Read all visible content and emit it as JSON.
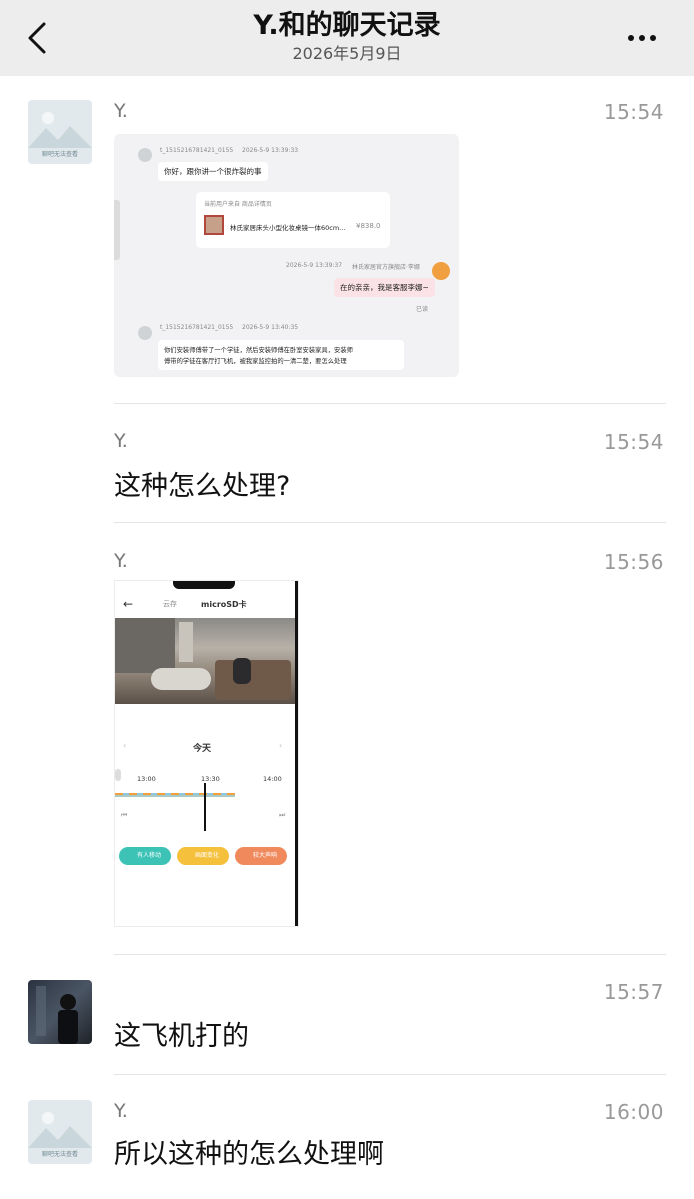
{
  "header": {
    "title": "Y.和的聊天记录",
    "date": "2026年5月9日",
    "back_icon": "chevron-left-icon",
    "more_icon": "more-dots-icon"
  },
  "messages": [
    {
      "name": "Y.",
      "time": "15:54",
      "avatar_text": "聊吧无法查看",
      "type": "image",
      "screenshot": {
        "user_id_1": "t_1515216781421_0155",
        "ts_1": "2026-5-9 13:39:33",
        "msg_1": "你好，跟你讲一个很炸裂的事",
        "product_src": "当前用户来自 商品详情页",
        "product_name": "林氏家居床头小型化妆桌镜一体60cm...",
        "product_price": "¥838.0",
        "ts_2": "2026-5-9 13:39:37",
        "shop_name": "林氏家居官方旗舰店·李娜",
        "msg_2": "在的亲亲，我是客服李娜~",
        "read_status": "已读",
        "user_id_2": "t_1515216781421_0155",
        "ts_3": "2026-5-9 13:40:35",
        "msg_3a": "你们安装师傅带了一个学徒，然后安装师傅在卧室安装家具，安装师",
        "msg_3b": "傅带的学徒在客厅打飞机，被我家监控拍的一清二楚，要怎么处理"
      }
    },
    {
      "name": "Y.",
      "time": "15:54",
      "type": "text",
      "text": "这种怎么处理?"
    },
    {
      "name": "Y.",
      "time": "15:56",
      "type": "image",
      "screenshot": {
        "tab_cloud": "云存",
        "tab_sd": "microSD卡",
        "day_label": "今天",
        "tick_1": "13:00",
        "tick_2": "13:30",
        "tick_3": "14:00",
        "btn_1": "有人移动",
        "btn_2": "画面变化",
        "btn_3": "较大声响"
      }
    },
    {
      "name": "",
      "time": "15:57",
      "type": "text",
      "text": "这飞机打的"
    },
    {
      "name": "Y.",
      "time": "16:00",
      "type": "text",
      "text": "所以这种的怎么处理啊",
      "avatar_text": "聊吧无法查看"
    }
  ],
  "colors": {
    "header_bg": "#ededed",
    "bubble_pink": "#fbe2e6",
    "pill_teal": "#3cc3b5",
    "pill_yellow": "#f5c13d",
    "pill_orange": "#f08a5d"
  }
}
